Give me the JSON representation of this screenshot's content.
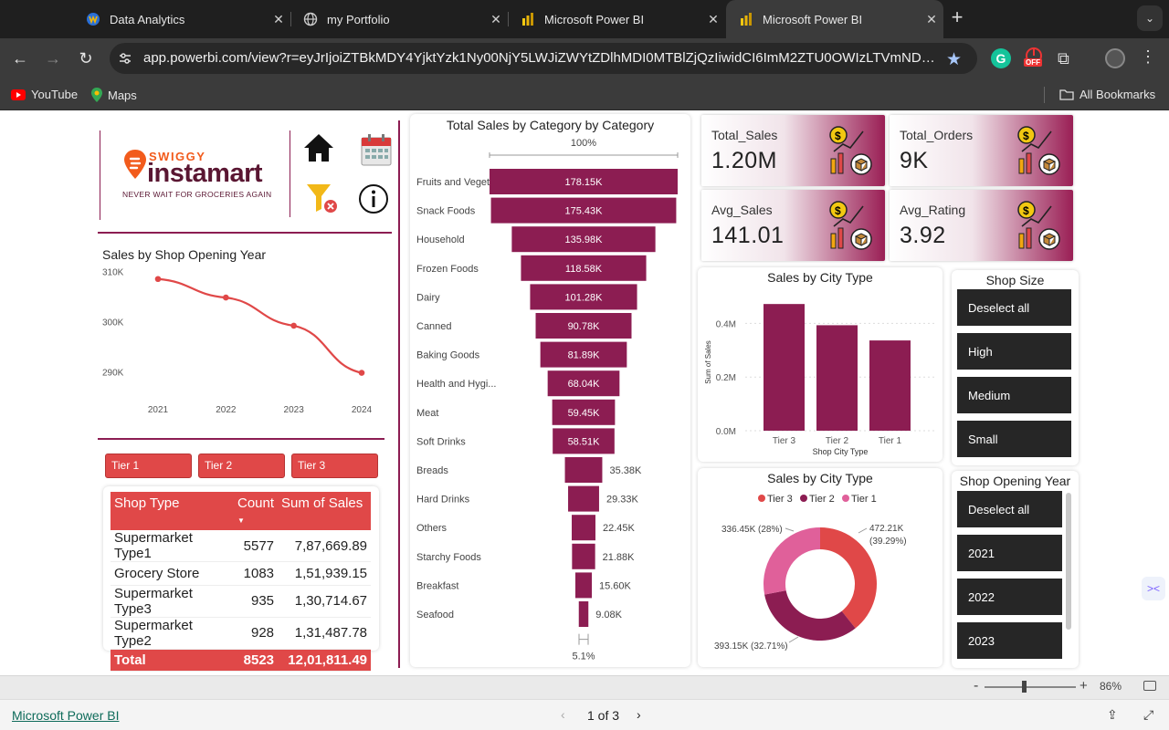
{
  "browser": {
    "tabs": [
      {
        "label": "Data Analytics",
        "icon": "data-analytics-icon"
      },
      {
        "label": "my Portfolio",
        "icon": "globe-icon"
      },
      {
        "label": "Microsoft Power BI",
        "icon": "powerbi-icon"
      },
      {
        "label": "Microsoft Power BI",
        "icon": "powerbi-icon",
        "active": true
      }
    ],
    "url": "app.powerbi.com/view?r=eyJrIjoiZTBkMDY4YjktYzk1Ny00NjY5LWJiZWYtZDlhMDI0MTBlZjQzIiwidCI6ImM2ZTU0OWIzLTVmNDUt...",
    "bookmarks": [
      {
        "label": "YouTube",
        "icon": "youtube-icon"
      },
      {
        "label": "Maps",
        "icon": "maps-icon"
      }
    ],
    "all_bookmarks": "All Bookmarks",
    "extension_badge": "OFF"
  },
  "logo": {
    "brand_top": "SWIGGY",
    "brand": "instamart",
    "tagline": "NEVER WAIT FOR GROCERIES AGAIN"
  },
  "kpis": [
    {
      "label": "Total_Sales",
      "value": "1.20M"
    },
    {
      "label": "Total_Orders",
      "value": "9K"
    },
    {
      "label": "Avg_Sales",
      "value": "141.01"
    },
    {
      "label": "Avg_Rating",
      "value": "3.92"
    }
  ],
  "line_chart": {
    "title": "Sales by Shop Opening Year",
    "chart_data": {
      "type": "line",
      "x": [
        "2021",
        "2022",
        "2023",
        "2024"
      ],
      "values": [
        308500,
        304800,
        299200,
        289800
      ],
      "ylim": [
        287000,
        311000
      ],
      "yticks": [
        {
          "v": 310000,
          "label": "310K"
        },
        {
          "v": 300000,
          "label": "300K"
        },
        {
          "v": 290000,
          "label": "290K"
        }
      ],
      "color": "#e04848"
    }
  },
  "tiers": [
    "Tier 1",
    "Tier 2",
    "Tier 3"
  ],
  "table": {
    "headers": [
      "Shop Type",
      "Count",
      "Sum of Sales"
    ],
    "rows": [
      [
        "Supermarket Type1",
        "5577",
        "7,87,669.89"
      ],
      [
        "Grocery Store",
        "1083",
        "1,51,939.15"
      ],
      [
        "Supermarket Type3",
        "935",
        "1,30,714.67"
      ],
      [
        "Supermarket Type2",
        "928",
        "1,31,487.78"
      ]
    ],
    "total": [
      "Total",
      "8523",
      "12,01,811.49"
    ]
  },
  "funnel": {
    "title": "Total Sales by Category by Category",
    "top_pct": "100%",
    "bottom_pct": "5.1%",
    "chart_data": {
      "type": "bar",
      "categories": [
        "Fruits and Veget...",
        "Snack Foods",
        "Household",
        "Frozen Foods",
        "Dairy",
        "Canned",
        "Baking Goods",
        "Health and Hygi...",
        "Meat",
        "Soft Drinks",
        "Breads",
        "Hard Drinks",
        "Others",
        "Starchy Foods",
        "Breakfast",
        "Seafood"
      ],
      "values": [
        178150,
        175430,
        135980,
        118580,
        101280,
        90780,
        81890,
        68040,
        59450,
        58510,
        35380,
        29330,
        22450,
        21880,
        15600,
        9080
      ],
      "labels": [
        "178.15K",
        "175.43K",
        "135.98K",
        "118.58K",
        "101.28K",
        "90.78K",
        "81.89K",
        "68.04K",
        "59.45K",
        "58.51K",
        "35.38K",
        "29.33K",
        "22.45K",
        "21.88K",
        "15.60K",
        "9.08K"
      ],
      "color": "#8c1d52"
    }
  },
  "city_bar": {
    "title": "Sales by City Type",
    "chart_data": {
      "type": "bar",
      "categories": [
        "Tier 3",
        "Tier 2",
        "Tier 1"
      ],
      "values": [
        472210,
        393150,
        336450
      ],
      "ylim": [
        0,
        500000
      ],
      "yticks": [
        {
          "v": 0,
          "label": "0.0M"
        },
        {
          "v": 200000,
          "label": "0.2M"
        },
        {
          "v": 400000,
          "label": "0.4M"
        }
      ],
      "xlabel": "Shop City Type",
      "ylabel": "Sum of Sales",
      "color": "#8c1d52"
    }
  },
  "city_donut": {
    "title": "Sales by City Type",
    "chart_data": {
      "type": "pie",
      "categories": [
        "Tier 3",
        "Tier 2",
        "Tier 1"
      ],
      "values": [
        472210,
        393150,
        336450
      ],
      "labels": [
        "472.21K (39.29%)",
        "393.15K (32.71%)",
        "336.45K (28%)"
      ],
      "colors": [
        "#e04848",
        "#8c1d52",
        "#e0609a"
      ]
    }
  },
  "shop_size": {
    "title": "Shop Size",
    "options": [
      "Deselect all",
      "High",
      "Medium",
      "Small"
    ]
  },
  "shop_year": {
    "title": "Shop Opening Year",
    "options": [
      "Deselect all",
      "2021",
      "2022",
      "2023"
    ]
  },
  "status": {
    "zoom": "86%",
    "page": "1 of 3",
    "brand_link": "Microsoft Power BI"
  }
}
